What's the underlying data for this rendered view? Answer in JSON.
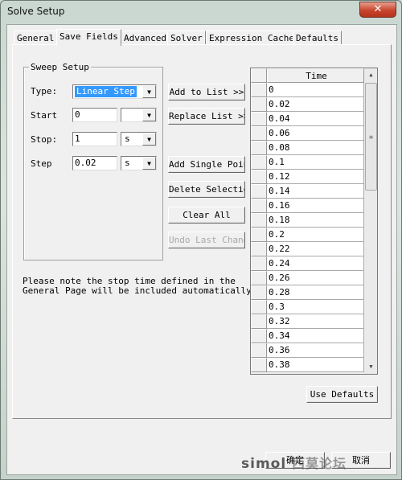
{
  "window": {
    "title": "Solve Setup",
    "close_icon": "close-icon"
  },
  "tabs": [
    {
      "label": "General"
    },
    {
      "label": "Save Fields",
      "active": true
    },
    {
      "label": "Advanced"
    },
    {
      "label": "Solver"
    },
    {
      "label": "Expression Cache"
    },
    {
      "label": "Defaults"
    }
  ],
  "sweep": {
    "group_label": "Sweep Setup",
    "type_label": "Type:",
    "type_value": "Linear Step",
    "start_label": "Start",
    "start_value": "0",
    "start_unit": "",
    "stop_label": "Stop:",
    "stop_value": "1",
    "stop_unit": "s",
    "step_label": "Step",
    "step_value": "0.02",
    "step_unit": "s"
  },
  "buttons": {
    "add_to_list": "Add to List >>",
    "replace_list": "Replace List >>",
    "add_single_point": "Add Single Point",
    "delete_selection": "Delete Selection",
    "clear_all": "Clear All",
    "undo_last_change": "Undo Last Change",
    "use_defaults": "Use Defaults",
    "ok": "确定",
    "cancel": "取消"
  },
  "note": "Please note the stop time defined in the\nGeneral Page will be included automatically.",
  "table": {
    "header": "Time",
    "rows": [
      "0",
      "0.02",
      "0.04",
      "0.06",
      "0.08",
      "0.1",
      "0.12",
      "0.14",
      "0.16",
      "0.18",
      "0.2",
      "0.22",
      "0.24",
      "0.26",
      "0.28",
      "0.3",
      "0.32",
      "0.34",
      "0.36",
      "0.38"
    ]
  },
  "watermark": {
    "text": "simol",
    "text_cn": "西莫论坛"
  }
}
